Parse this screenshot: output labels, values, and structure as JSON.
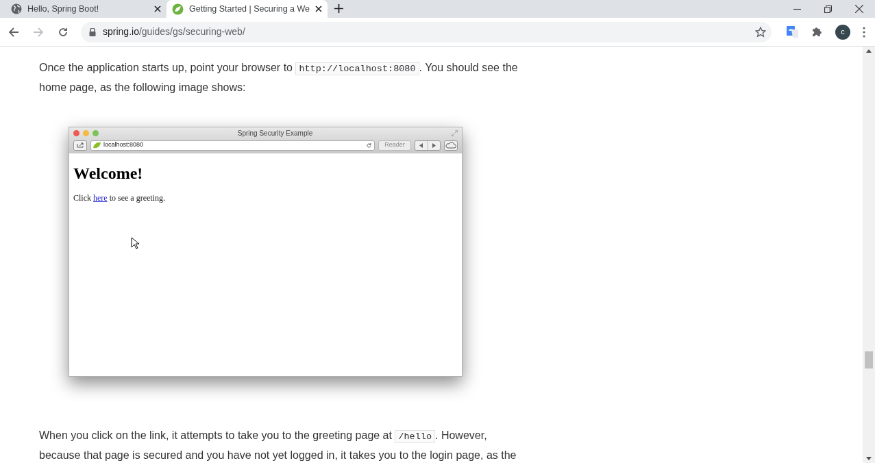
{
  "tabs": [
    {
      "title": "Hello, Spring Boot!",
      "selected": false
    },
    {
      "title": "Getting Started | Securing a We",
      "selected": true
    }
  ],
  "address": {
    "host": "spring.io",
    "path": "/guides/gs/securing-web/"
  },
  "profile": {
    "initial": "c"
  },
  "paragraphs": [
    {
      "lines": [
        [
          {
            "kind": "text",
            "text": "Once the application starts up, point your browser to "
          },
          {
            "kind": "code",
            "text": "http://localhost:8080"
          },
          {
            "kind": "text",
            "text": ". You should see the"
          }
        ],
        [
          {
            "kind": "text",
            "text": "home page, as the following image shows:"
          }
        ]
      ]
    }
  ],
  "screenshot": {
    "title": "Spring Security Example",
    "address": "localhost:8080",
    "reader": "Reader",
    "heading": "Welcome!",
    "line_before": "Click ",
    "link": "here",
    "line_after": " to see a greeting."
  },
  "paragraphs_after": [
    {
      "lines": [
        [
          {
            "kind": "text",
            "text": "When you click on the link, it attempts to take you to the greeting page at "
          },
          {
            "kind": "code",
            "text": "/hello"
          },
          {
            "kind": "text",
            "text": ". However,"
          }
        ],
        [
          {
            "kind": "text",
            "text": "because that page is secured and you have not yet logged in, it takes you to the login page, as the"
          }
        ]
      ]
    }
  ]
}
